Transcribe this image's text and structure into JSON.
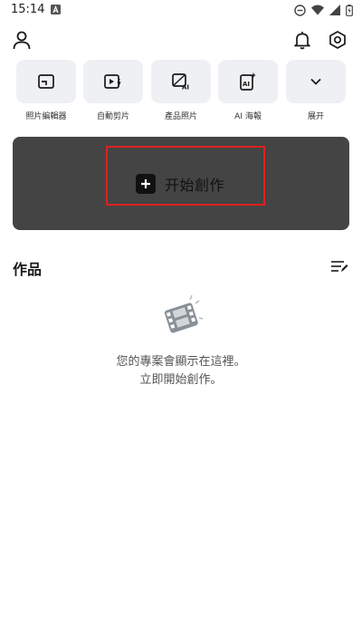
{
  "status_bar": {
    "time": "15:14"
  },
  "tools": [
    {
      "label": "照片編輯器",
      "icon": "photo-editor-icon"
    },
    {
      "label": "自動剪片",
      "icon": "auto-cut-icon"
    },
    {
      "label": "產品照片",
      "icon": "product-photo-icon"
    },
    {
      "label": "AI 海報",
      "icon": "ai-poster-icon"
    },
    {
      "label": "展开",
      "icon": "chevron-down-icon"
    }
  ],
  "create": {
    "label": "开始創作",
    "card_color": "#444444",
    "highlight_color": "#e02020"
  },
  "works": {
    "title": "作品",
    "empty_line1": "您的專案會顯示在這裡。",
    "empty_line2": "立即開始創作。"
  }
}
